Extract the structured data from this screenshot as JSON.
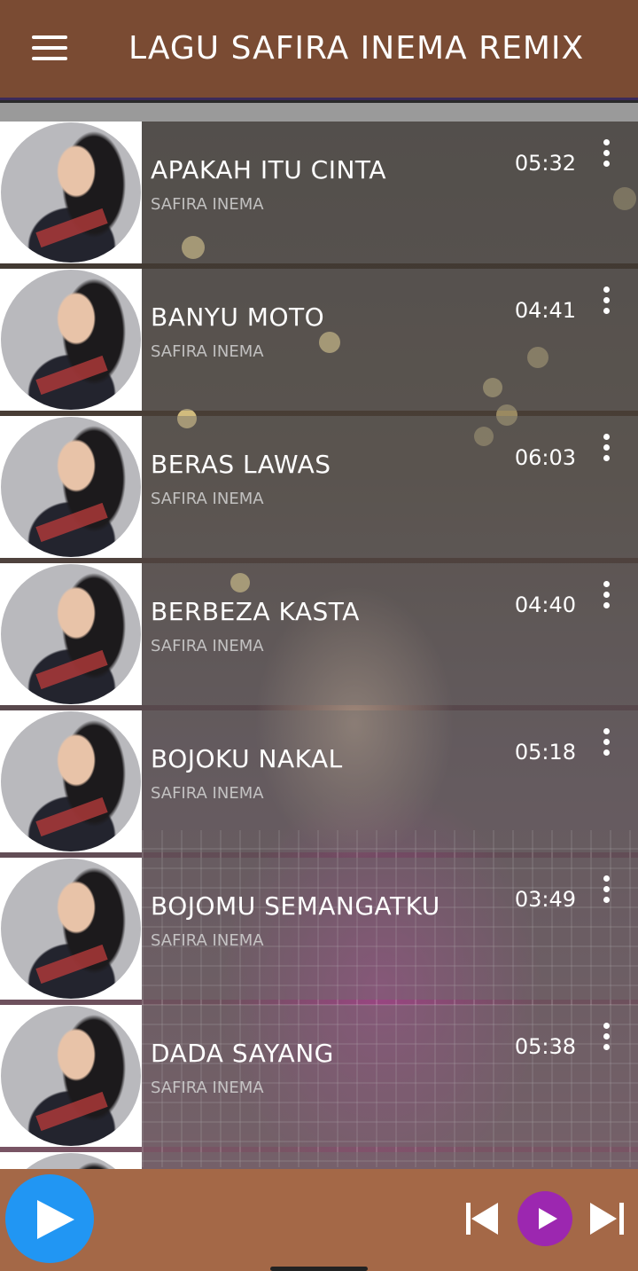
{
  "header": {
    "title": "LAGU SAFIRA INEMA REMIX",
    "menu_icon": "hamburger-menu-icon",
    "background": "#7a4b33"
  },
  "songs": [
    {
      "title": "APAKAH ITU CINTA",
      "artist": "SAFIRA INEMA",
      "duration": "05:32"
    },
    {
      "title": "BANYU MOTO",
      "artist": "SAFIRA INEMA",
      "duration": "04:41"
    },
    {
      "title": "BERAS LAWAS",
      "artist": "SAFIRA INEMA",
      "duration": "06:03"
    },
    {
      "title": "BERBEZA KASTA",
      "artist": "SAFIRA INEMA",
      "duration": "04:40"
    },
    {
      "title": "BOJOKU NAKAL",
      "artist": "SAFIRA INEMA",
      "duration": "05:18"
    },
    {
      "title": "BOJOMU SEMANGATKU",
      "artist": "SAFIRA INEMA",
      "duration": "03:49"
    },
    {
      "title": "DADA SAYANG",
      "artist": "SAFIRA INEMA",
      "duration": "05:38"
    }
  ],
  "player": {
    "background": "#a46847",
    "play_button_color": "#2196f3",
    "small_play_color": "#9c27b0",
    "icons": [
      "play-icon",
      "previous-icon",
      "play-icon",
      "next-icon"
    ]
  }
}
